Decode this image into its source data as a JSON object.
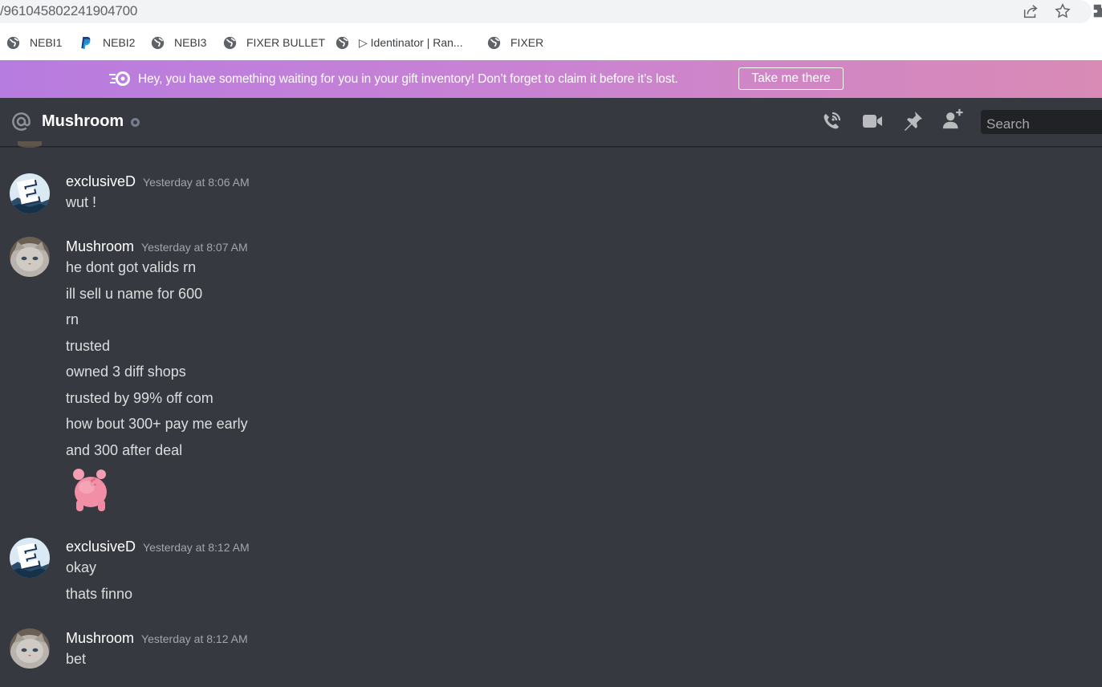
{
  "browser": {
    "url": "/961045802241904700",
    "icons": [
      "share-icon",
      "star-icon",
      "extensions-icon"
    ],
    "bookmarks": [
      {
        "label": "NEBI1",
        "icon": "globe-icon"
      },
      {
        "label": "NEBI2",
        "icon": "paypal-icon"
      },
      {
        "label": "NEBI3",
        "icon": "globe-icon"
      },
      {
        "label": "FIXER BULLET",
        "icon": "globe-icon"
      },
      {
        "label": "▷ Identinator | Ran...",
        "icon": "globe-icon"
      },
      {
        "label": "FIXER",
        "icon": "globe-icon"
      }
    ]
  },
  "banner": {
    "icon": "nitro-icon",
    "text": "Hey, you have something waiting for you in your gift inventory! Don’t forget to claim it before it’s lost.",
    "button_label": "Take me there",
    "gradient_start": "#b77ce0",
    "gradient_end": "#d98ab5"
  },
  "header": {
    "title": "Mushroom",
    "status": "offline",
    "icons": [
      "at-icon",
      "call-icon",
      "video-icon",
      "pin-icon",
      "add-user-icon"
    ],
    "search_placeholder": "Search"
  },
  "messages": [
    {
      "author": "exclusiveD",
      "avatar": "exclusived-avatar",
      "timestamp": "Yesterday at 8:06 AM",
      "lines": [
        "wut !"
      ]
    },
    {
      "author": "Mushroom",
      "avatar": "mushroom-avatar",
      "timestamp": "Yesterday at 8:07 AM",
      "lines": [
        "he dont got valids rn",
        "ill sell u name for 600",
        "rn",
        "trusted",
        "owned 3 diff shops",
        "trusted by 99% off com",
        "how bout 300+ pay me early",
        "and 300 after deal"
      ],
      "sticker": "pig-sticker"
    },
    {
      "author": "exclusiveD",
      "avatar": "exclusived-avatar",
      "timestamp": "Yesterday at 8:12 AM",
      "lines": [
        "okay",
        "thats finno"
      ]
    },
    {
      "author": "Mushroom",
      "avatar": "mushroom-avatar",
      "timestamp": "Yesterday at 8:12 AM",
      "lines": [
        "bet"
      ]
    }
  ],
  "colors": {
    "background": "#36393f",
    "text": "#dcddde",
    "muted": "#a3a6aa",
    "search_bg": "#202225"
  }
}
